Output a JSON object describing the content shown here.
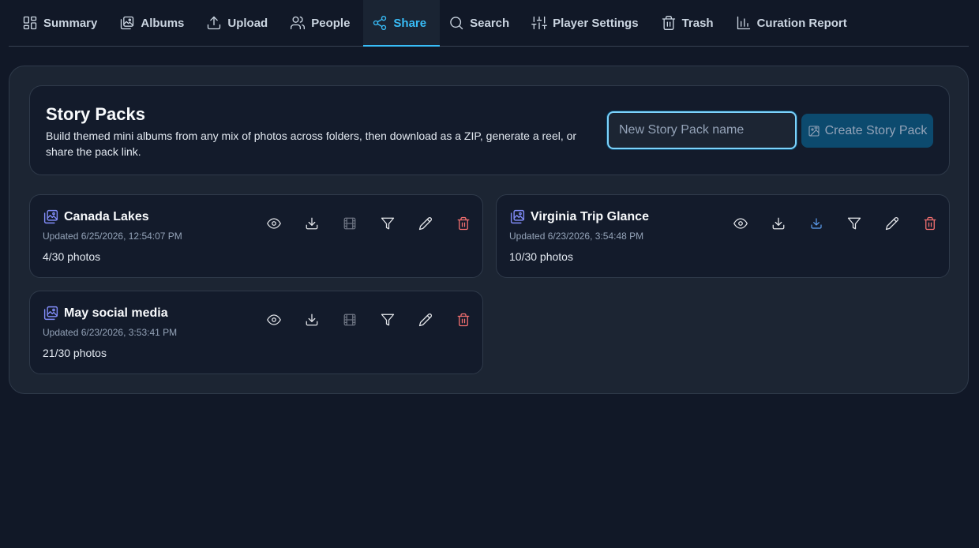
{
  "nav": {
    "tabs": [
      {
        "label": "Summary",
        "icon": "grid-icon"
      },
      {
        "label": "Albums",
        "icon": "albums-icon"
      },
      {
        "label": "Upload",
        "icon": "upload-icon"
      },
      {
        "label": "People",
        "icon": "people-icon"
      },
      {
        "label": "Share",
        "icon": "share-icon",
        "active": true
      },
      {
        "label": "Search",
        "icon": "search-icon"
      },
      {
        "label": "Player Settings",
        "icon": "sliders-icon"
      },
      {
        "label": "Trash",
        "icon": "trash-icon"
      },
      {
        "label": "Curation Report",
        "icon": "bar-chart-icon"
      }
    ]
  },
  "story_packs": {
    "title": "Story Packs",
    "description": "Build themed mini albums from any mix of photos across folders, then download as a ZIP, generate a reel, or share the pack link.",
    "name_input": {
      "value": "",
      "placeholder": "New Story Pack name"
    },
    "create_button_label": "Create Story Pack",
    "packs": [
      {
        "name": "Canada Lakes",
        "updated": "Updated 6/25/2026, 12:54:07 PM",
        "count": "4/30 photos",
        "reel_state": "disabled"
      },
      {
        "name": "Virginia Trip Glance",
        "updated": "Updated 6/23/2026, 3:54:48 PM",
        "count": "10/30 photos",
        "reel_state": "ready"
      },
      {
        "name": "May social media",
        "updated": "Updated 6/23/2026, 3:53:41 PM",
        "count": "21/30 photos",
        "reel_state": "disabled"
      }
    ]
  },
  "colors": {
    "accent": "#38bdf8",
    "pack_icon": "#818cf8",
    "delete": "#f87171",
    "reel_ready": "#60a5fa",
    "background": "#111827"
  }
}
